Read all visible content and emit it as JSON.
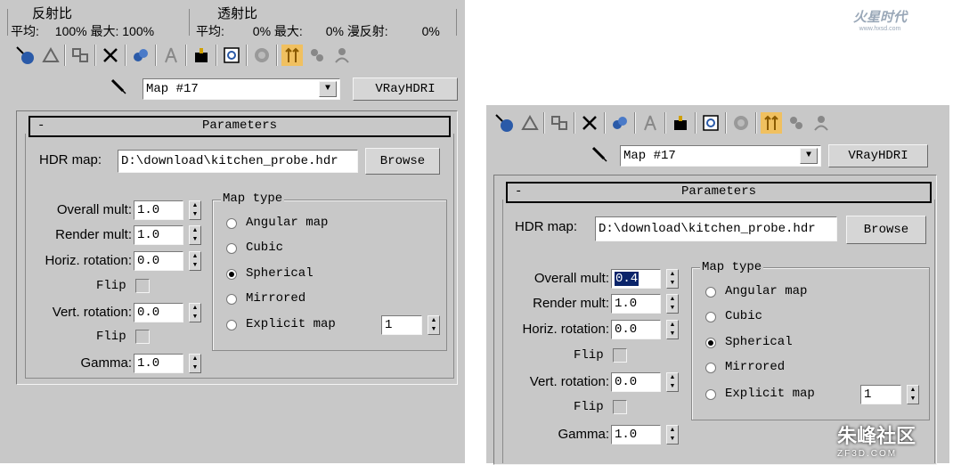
{
  "top_header": {
    "reflect_title": "反射比",
    "refract_title": "透射比",
    "reflect_stats": {
      "avg_label": "平均:",
      "avg_value": "100%",
      "max_label": "最大:",
      "max_value": "100%"
    },
    "refract_stats": {
      "avg_label": "平均:",
      "avg_value": "0%",
      "max_label": "最大:",
      "max_value": "0%",
      "diffuse_label": "漫反射:",
      "diffuse_value": "0%"
    }
  },
  "toolbar": {
    "icons": [
      "get-material-icon",
      "put-to-scene-icon",
      "assign-to-selection-icon",
      "reset-map-icon",
      "make-unique-icon",
      "put-to-library-icon",
      "material-id-icon",
      "show-map-icon",
      "show-end-result-icon",
      "go-to-parent-icon",
      "go-forward-icon"
    ]
  },
  "map_row": {
    "picker_icon": "eyedropper-icon",
    "map_name": "Map #17",
    "map_type_button": "VRayHDRI"
  },
  "parameters": {
    "rollout_minus": "-",
    "rollout_title": "Parameters",
    "hdr_map_label": "HDR map:",
    "hdr_map_path": "D:\\download\\kitchen_probe.hdr",
    "browse_label": "Browse",
    "overall_mult_label": "Overall mult:",
    "render_mult_label": "Render mult:",
    "horiz_rotation_label": "Horiz. rotation:",
    "vert_rotation_label": "Vert. rotation:",
    "flip_label": "Flip",
    "gamma_label": "Gamma:",
    "render_mult_value": "1.0",
    "horiz_rotation_value": "0.0",
    "vert_rotation_value": "0.0",
    "gamma_value": "1.0",
    "map_type_title": "Map type",
    "map_types": [
      "Angular map",
      "Cubic",
      "Spherical",
      "Mirrored",
      "Explicit map"
    ],
    "selected_map_type": "Spherical",
    "explicit_map_channel": "1"
  },
  "left_panel": {
    "overall_mult_value": "1.0"
  },
  "right_panel": {
    "overall_mult_value": "0.4"
  },
  "watermarks": {
    "top_right": "火星时代",
    "top_right_url": "www.hxsd.com",
    "bottom_right": "朱峰社区",
    "bottom_right_url": "ZF3D.COM"
  },
  "colors": {
    "panel_bg": "#c8c8c8",
    "highlight": "#0a246a",
    "active_icon_bg": "#f0c060"
  }
}
